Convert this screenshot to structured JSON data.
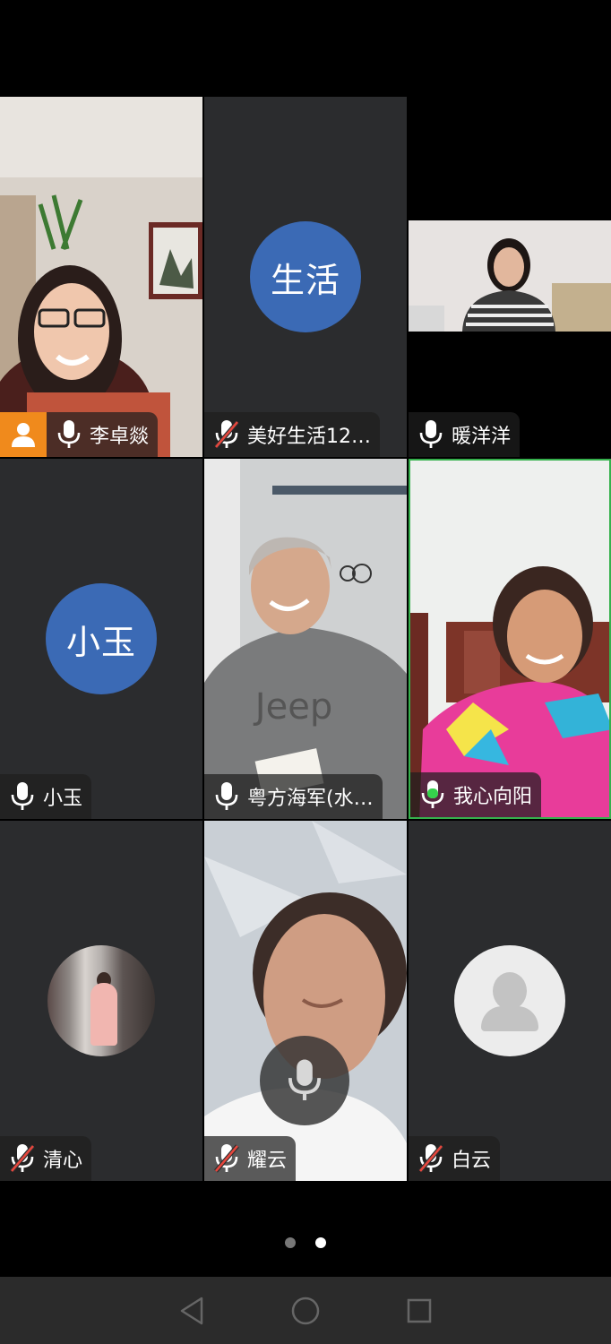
{
  "participants": [
    {
      "name": "李卓燚",
      "mic": "on",
      "host": true,
      "video": true
    },
    {
      "name": "美好生活12…",
      "mic": "muted",
      "avatar_text": "生活",
      "avatar_color": "#3b6ab5"
    },
    {
      "name": "暖洋洋",
      "mic": "on",
      "video": true
    },
    {
      "name": "小玉",
      "mic": "on",
      "avatar_text": "小玉",
      "avatar_color": "#3b6ab5"
    },
    {
      "name": "粤方海军(水…",
      "mic": "on",
      "video": true
    },
    {
      "name": "我心向阳",
      "mic": "speaking",
      "video": true,
      "active_speaker": true
    },
    {
      "name": "清心",
      "mic": "muted",
      "avatar": "photo"
    },
    {
      "name": "耀云",
      "mic": "muted",
      "video": true
    },
    {
      "name": "白云",
      "mic": "muted",
      "avatar": "placeholder"
    }
  ],
  "pager": {
    "pages": 2,
    "current": 2
  },
  "colors": {
    "tile_bg": "#2b2c2e",
    "avatar_blue": "#3b6ab5",
    "host_orange": "#f08a1c",
    "speaking_green": "#35b14c"
  },
  "icons": [
    "microphone-icon",
    "microphone-muted-icon",
    "host-person-icon",
    "back-triangle-icon",
    "home-circle-icon",
    "recents-square-icon"
  ]
}
